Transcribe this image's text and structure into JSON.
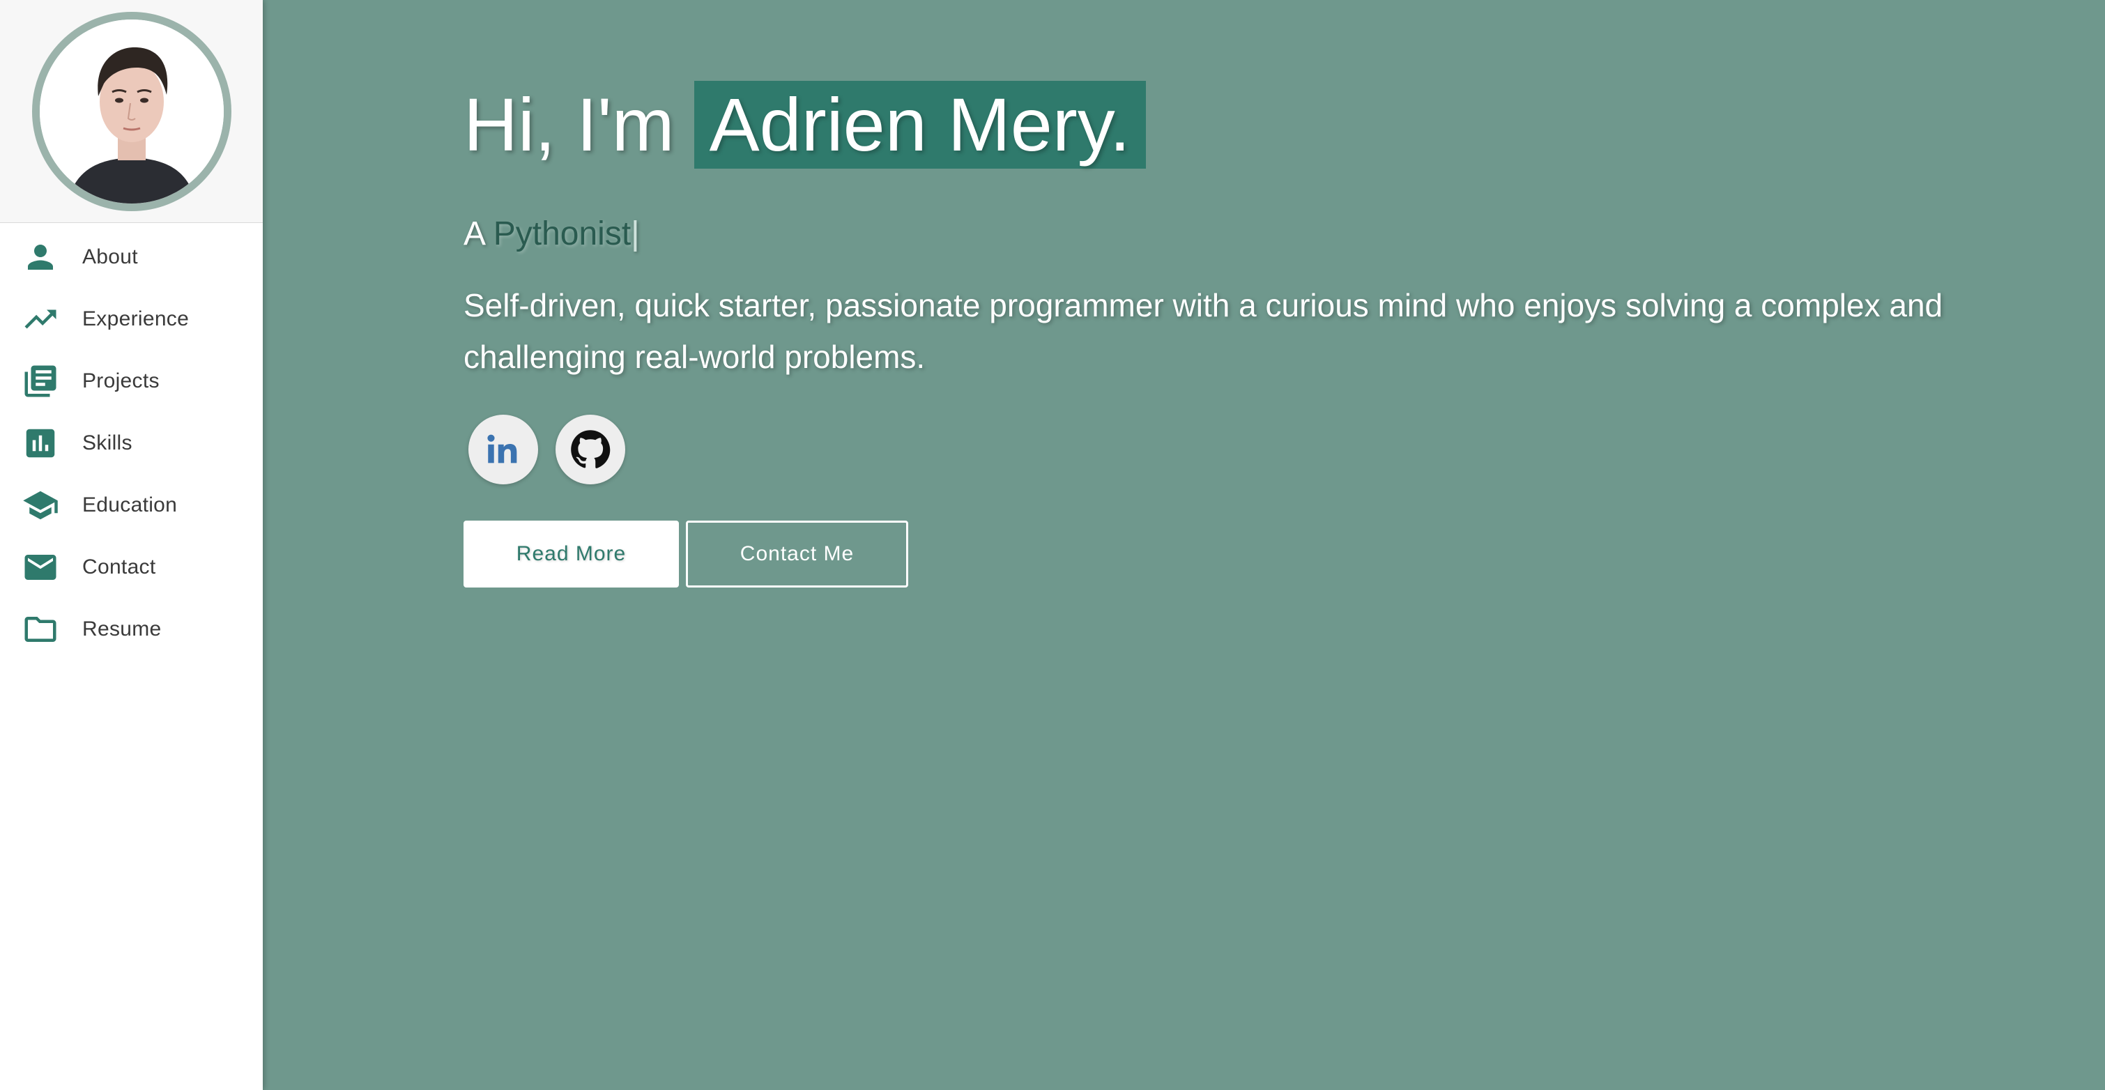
{
  "sidebar": {
    "avatar_alt": "Adrien Mery",
    "items": [
      {
        "label": "About",
        "icon": "person-icon"
      },
      {
        "label": "Experience",
        "icon": "trending-up-icon"
      },
      {
        "label": "Projects",
        "icon": "library-books-icon"
      },
      {
        "label": "Skills",
        "icon": "bar-chart-icon"
      },
      {
        "label": "Education",
        "icon": "school-icon"
      },
      {
        "label": "Contact",
        "icon": "mail-icon"
      },
      {
        "label": "Resume",
        "icon": "folder-icon"
      }
    ]
  },
  "hero": {
    "greeting": "Hi, I'm",
    "name": "Adrien Mery.",
    "role_prefix": "A",
    "role_typed": "Pythonist",
    "role_cursor": "|",
    "bio": "Self-driven, quick starter, passionate programmer with a curious mind who enjoys solving a complex and challenging real-world problems.",
    "socials": [
      {
        "icon": "linkedin-icon"
      },
      {
        "icon": "github-icon"
      }
    ],
    "read_more": "Read More",
    "contact_me": "Contact Me"
  },
  "colors": {
    "accent": "#2f7a6c",
    "background": "#6f988d",
    "sidebar_bg": "#ffffff"
  }
}
